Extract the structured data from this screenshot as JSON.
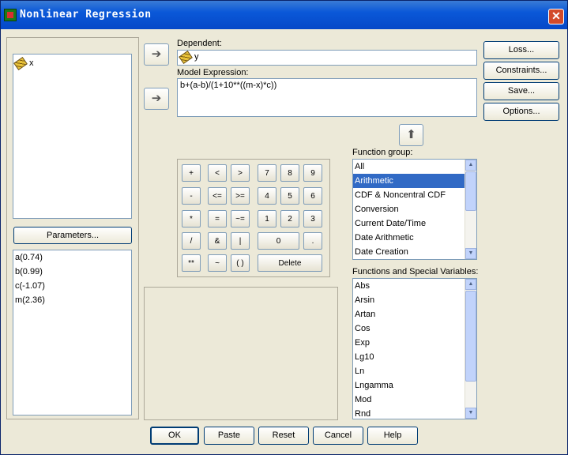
{
  "window": {
    "title": "Nonlinear Regression",
    "close_glyph": "✕"
  },
  "variables": [
    {
      "name": "x",
      "icon": "ruler-icon"
    }
  ],
  "dependent": {
    "label": "Dependent:",
    "value": "y",
    "icon": "ruler-icon"
  },
  "model": {
    "label": "Model Expression:",
    "value": "b+(a-b)/(1+10**((m-x)*c))"
  },
  "parameters_button": "Parameters...",
  "parameters": [
    "a(0.74)",
    "b(0.99)",
    "c(-1.07)",
    "m(2.36)"
  ],
  "right_buttons": {
    "loss": "Loss...",
    "constraints": "Constraints...",
    "save": "Save...",
    "options": "Options..."
  },
  "keypad": [
    {
      "k": "+"
    },
    {
      "k": "<"
    },
    {
      "k": ">"
    },
    {
      "k": "7"
    },
    {
      "k": "8"
    },
    {
      "k": "9"
    },
    {
      "k": "-"
    },
    {
      "k": "<="
    },
    {
      "k": ">="
    },
    {
      "k": "4"
    },
    {
      "k": "5"
    },
    {
      "k": "6"
    },
    {
      "k": "*"
    },
    {
      "k": "="
    },
    {
      "k": "~="
    },
    {
      "k": "1"
    },
    {
      "k": "2"
    },
    {
      "k": "3"
    },
    {
      "k": "/"
    },
    {
      "k": "&"
    },
    {
      "k": "|"
    },
    {
      "k": "0"
    },
    {
      "k": "."
    },
    {
      "k": "**"
    },
    {
      "k": "~"
    },
    {
      "k": "( )"
    },
    {
      "k": "Delete"
    }
  ],
  "function_group": {
    "label": "Function group:",
    "items": [
      "All",
      "Arithmetic",
      "CDF & Noncentral CDF",
      "Conversion",
      "Current Date/Time",
      "Date Arithmetic",
      "Date Creation"
    ],
    "selected": "Arithmetic"
  },
  "functions": {
    "label": "Functions and Special Variables:",
    "items": [
      "Abs",
      "Arsin",
      "Artan",
      "Cos",
      "Exp",
      "Lg10",
      "Ln",
      "Lngamma",
      "Mod",
      "Rnd"
    ]
  },
  "bottom_buttons": {
    "ok": "OK",
    "paste": "Paste",
    "reset": "Reset",
    "cancel": "Cancel",
    "help": "Help"
  }
}
